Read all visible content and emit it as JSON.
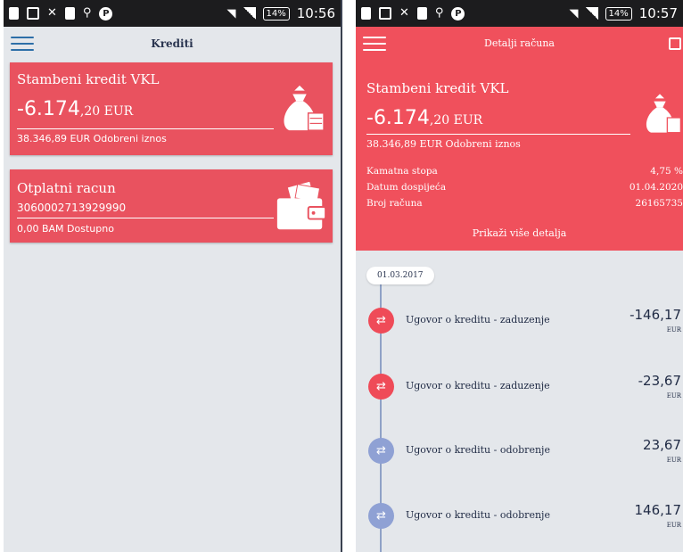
{
  "left": {
    "status": {
      "time": "10:56",
      "battery": "14%"
    },
    "appbar": {
      "title": "Krediti"
    },
    "loan_card": {
      "title": "Stambeni kredit VKL",
      "amount_main": "-6.174",
      "amount_dec": ",20 EUR",
      "approved": "38.346,89 EUR Odobreni iznos",
      "icon": "money-bag-icon"
    },
    "account_card": {
      "title": "Otplatni racun",
      "number": "3060002713929990",
      "available": "0,00 BAM Dostupno",
      "icon": "wallet-icon"
    }
  },
  "right": {
    "status": {
      "time": "10:57",
      "battery": "14%"
    },
    "appbar": {
      "title": "Detalji računa"
    },
    "header": {
      "title": "Stambeni kredit VKL",
      "amount_main": "-6.174",
      "amount_dec": ",20 EUR",
      "approved": "38.346,89 EUR Odobreni iznos"
    },
    "details": [
      {
        "label": "Kamatna stopa",
        "value": "4,75 %"
      },
      {
        "label": "Datum dospijeća",
        "value": "01.04.2020"
      },
      {
        "label": "Broj računa",
        "value": "26165735"
      }
    ],
    "more_label": "Prikaži više detalja",
    "date": "01.03.2017",
    "transactions": [
      {
        "label": "Ugovor o kreditu - zaduzenje",
        "amount": "-146,17",
        "currency": "EUR",
        "kind": "debit"
      },
      {
        "label": "Ugovor o kreditu - zaduzenje",
        "amount": "-23,67",
        "currency": "EUR",
        "kind": "debit"
      },
      {
        "label": "Ugovor o kreditu - odobrenje",
        "amount": "23,67",
        "currency": "EUR",
        "kind": "credit"
      },
      {
        "label": "Ugovor o kreditu - odobrenje",
        "amount": "146,17",
        "currency": "EUR",
        "kind": "credit"
      }
    ]
  },
  "colors": {
    "accent_red": "#e9525f",
    "timeline_blue": "#8fa1d4",
    "text_dark": "#1f2a44"
  }
}
